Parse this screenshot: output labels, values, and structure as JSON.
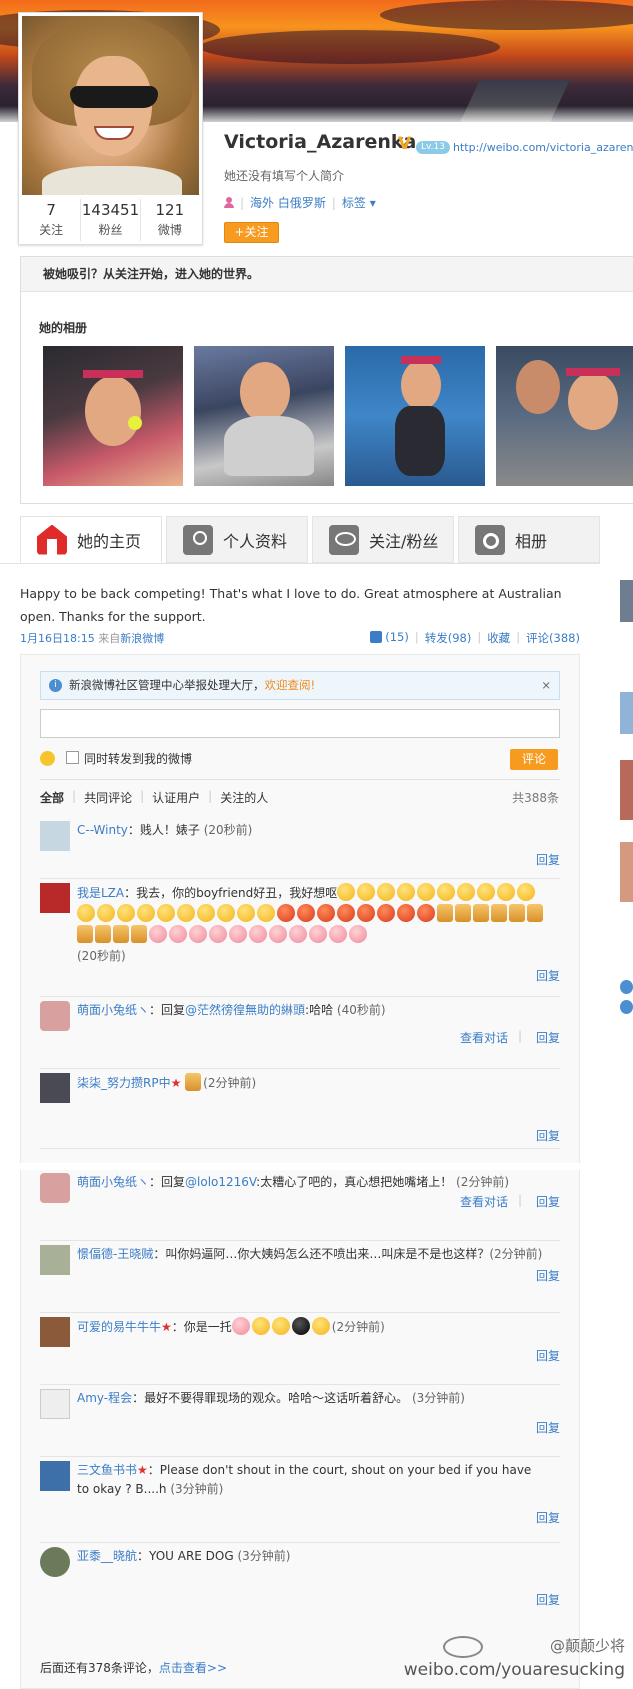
{
  "profile": {
    "name": "Victoria_Azarenka",
    "verified_badge": "V",
    "level": "Lv.13",
    "url": "http://weibo.com/victoria_azarenk",
    "bio": "她还没有填写个人简介",
    "location": "海外 白俄罗斯",
    "tags_label": "标签",
    "follow_button": "+关注",
    "stats": [
      {
        "num": "7",
        "label": "关注"
      },
      {
        "num": "143451",
        "label": "粉丝"
      },
      {
        "num": "121",
        "label": "微博"
      }
    ]
  },
  "promo": {
    "headline": "被她吸引？从关注开始，进入她的世界。",
    "album_title": "她的相册"
  },
  "tabs": [
    {
      "label": "她的主页",
      "icon": "home-icon"
    },
    {
      "label": "个人资料",
      "icon": "person-icon"
    },
    {
      "label": "关注/粉丝",
      "icon": "people-icon"
    },
    {
      "label": "相册",
      "icon": "camera-icon"
    }
  ],
  "post": {
    "text": "Happy to be back competing! That's what I love to do. Great atmosphere at Australian open. Thanks for the support.",
    "time": "1月16日18:15",
    "source_prefix": "来自",
    "source": "新浪微博",
    "like": "(15)",
    "repost": "转发(98)",
    "favorite": "收藏",
    "comment": "评论(388)"
  },
  "comment_box": {
    "notice_text": "新浪微博社区管理中心举报处理大厅，",
    "notice_link": "欢迎查阅!",
    "notice_close": "×",
    "repost_checkbox_label": "同时转发到我的微博",
    "submit": "评论",
    "filters": [
      "全部",
      "共同评论",
      "认证用户",
      "关注的人"
    ],
    "total": "共388条",
    "reply_label": "回复",
    "conversation_label": "查看对话",
    "more_text": "后面还有378条评论，",
    "more_link": "点击查看>>"
  },
  "comments": [
    {
      "user": "C--Winty",
      "text": "：贱人！婊子 ",
      "time": "(20秒前)"
    },
    {
      "user": "我是LZA",
      "text": "：我去，你的boyfriend好丑，我好想呕",
      "time": "(20秒前)"
    },
    {
      "user": "萌面小兔纸ヽ",
      "text": "：回复",
      "mention": "@茫然徬徨無助的綝頭",
      "text2": ":哈哈 ",
      "time": "(40秒前)"
    },
    {
      "user": "柒柒_努力攒RP中",
      "text": " ",
      "time": "(2分钟前)"
    },
    {
      "user": "萌面小兔纸ヽ",
      "text": "：回复",
      "mention": "@lolo1216V",
      "text2": ":太糟心了吧的，真心想把她嘴堵上！ ",
      "time": "(2分钟前)"
    },
    {
      "user": "憬偪德-王晓贼",
      "text": "：叫你妈逼阿…你大姨妈怎么还不喷出来…叫床是不是也这样？",
      "time": "(2分钟前)"
    },
    {
      "user": "可爱的易牛牛牛",
      "text": "：你是一托",
      "time": "(2分钟前)"
    },
    {
      "user": "Amy-程会",
      "text": "：最好不要得罪现场的观众。哈哈～这话听着舒心。 ",
      "time": "(3分钟前)"
    },
    {
      "user": "三文鱼书书",
      "text": "：Please don't shout in the court, shout on your bed if you have to okay ? B....h ",
      "time": "(3分钟前)"
    },
    {
      "user": "亚黍__晓航",
      "text": "：YOU ARE DOG ",
      "time": "(3分钟前)"
    }
  ],
  "watermark": {
    "handle": "@颠颠少将",
    "url": "weibo.com/youaresucking"
  },
  "colors": {
    "accent_orange": "#f79b20",
    "link_blue": "#3b7dc7"
  }
}
